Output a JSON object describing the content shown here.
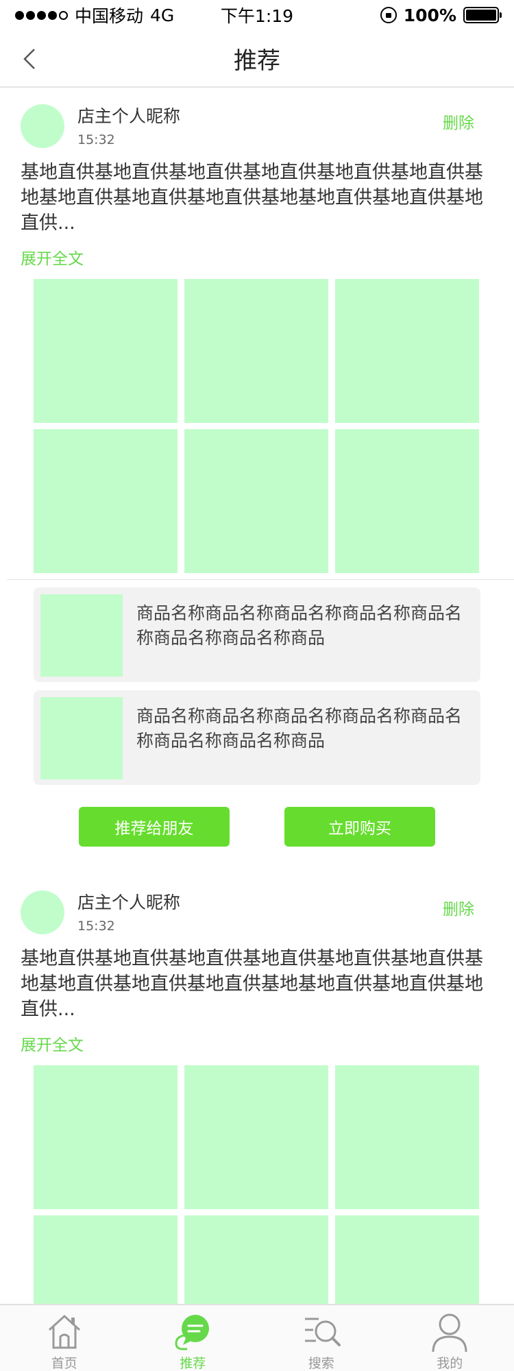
{
  "status_bar": {
    "carrier": "中国移动",
    "network": "4G",
    "time": "下午1:19",
    "battery": "100%",
    "battery_level": 1.0
  },
  "nav": {
    "title": "推荐"
  },
  "posts": [
    {
      "nickname": "店主个人昵称",
      "time": "15:32",
      "delete_label": "删除",
      "text": "基地直供基地直供基地直供基地直供基地直供基地直供基地基地直供基地直供基地直供基地基地直供基地直供基地直供...",
      "expand_label": "展开全文",
      "products": [
        {
          "name": "商品名称商品名称商品名称商品名称商品名称商品名称商品名称商品"
        },
        {
          "name": "商品名称商品名称商品名称商品名称商品名称商品名称商品名称商品"
        }
      ],
      "recommend_label": "推荐给朋友",
      "buy_label": "立即购买"
    },
    {
      "nickname": "店主个人昵称",
      "time": "15:32",
      "delete_label": "删除",
      "text": "基地直供基地直供基地直供基地直供基地直供基地直供基地基地直供基地直供基地直供基地基地直供基地直供基地直供...",
      "expand_label": "展开全文"
    }
  ],
  "tabs": [
    {
      "label": "首页",
      "icon": "home-icon"
    },
    {
      "label": "推荐",
      "icon": "chat-bubble-icon",
      "active": true
    },
    {
      "label": "搜索",
      "icon": "search-list-icon"
    },
    {
      "label": "我的",
      "icon": "user-icon"
    }
  ],
  "colors": {
    "accent": "#66d94b",
    "button": "#66dd2e",
    "placeholder": "#c1fdcb",
    "card_bg": "#f2f2f2"
  }
}
